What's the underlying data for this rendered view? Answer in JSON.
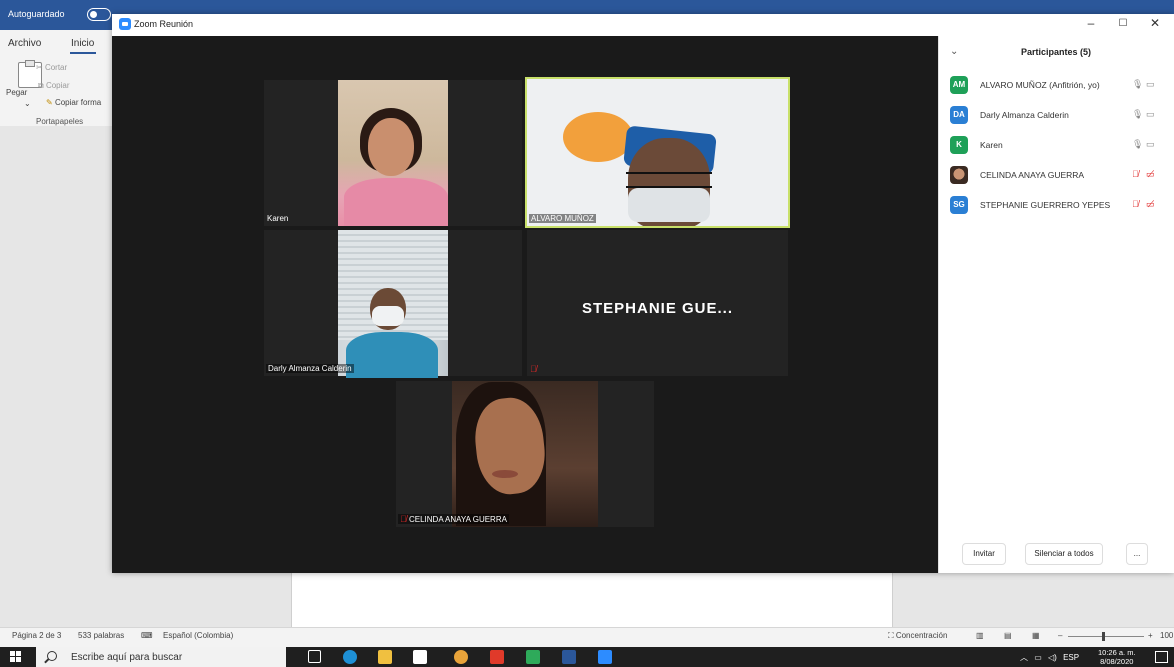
{
  "word": {
    "autosave_label": "Autoguardado",
    "tabs": [
      "Archivo",
      "Inicio"
    ],
    "ribbon": {
      "paste": "Pegar",
      "cut": "Cortar",
      "copy": "Copiar",
      "copy_format": "Copiar forma",
      "group": "Portapapeles"
    },
    "status": {
      "page": "Página 2 de 3",
      "words": "533 palabras",
      "language": "Español (Colombia)",
      "focus": "Concentración",
      "zoom": "100"
    }
  },
  "taskbar": {
    "search_placeholder": "Escribe aquí para buscar",
    "language": "ESP",
    "time": "10:26 a. m.",
    "date": "8/08/2020",
    "apps": [
      {
        "icon": "task-view-icon",
        "color": "#ffffff"
      },
      {
        "icon": "edge-icon",
        "color": "#1e90d6"
      },
      {
        "icon": "file-explorer-icon",
        "color": "#f0c040"
      },
      {
        "icon": "store-icon",
        "color": "#ffffff"
      },
      {
        "icon": "chrome-icon",
        "color": "#e8a33a"
      },
      {
        "icon": "acrobat-icon",
        "color": "#e03a2a"
      },
      {
        "icon": "whiteboard-icon",
        "color": "#2eaa5a"
      },
      {
        "icon": "word-icon",
        "color": "#2b579a"
      },
      {
        "icon": "zoom-icon",
        "color": "#2d8cff"
      }
    ]
  },
  "zoom": {
    "window_title": "Zoom Reunión",
    "controls": [
      "–",
      "☐",
      "✕"
    ],
    "tiles": {
      "karen": "Karen",
      "alvaro": "ALVARO MUÑOZ",
      "darly": "Darly Almanza Calderin",
      "stephanie": "STEPHANIE GUE...",
      "celinda": "CELINDA ANAYA GUERRA"
    },
    "panel": {
      "title": "Participantes (5)",
      "participants": [
        {
          "initials": "AM",
          "name": "ALVARO MUÑOZ (Anfitrión, yo)",
          "color": "#1ea058",
          "muted": false,
          "video_off": false
        },
        {
          "initials": "DA",
          "name": "Darly Almanza Calderin",
          "color": "#2a7fd4",
          "muted": false,
          "video_off": false
        },
        {
          "initials": "K",
          "name": "Karen",
          "color": "#1ea058",
          "muted": false,
          "video_off": false
        },
        {
          "initials": "",
          "name": "CELINDA ANAYA GUERRA",
          "color": "#a8704f",
          "muted": true,
          "video_off": true
        },
        {
          "initials": "SG",
          "name": "STEPHANIE GUERRERO YEPES",
          "color": "#2a7fd4",
          "muted": true,
          "video_off": true
        }
      ],
      "buttons": {
        "invite": "Invitar",
        "mute_all": "Silenciar a todos",
        "more": "..."
      }
    }
  }
}
